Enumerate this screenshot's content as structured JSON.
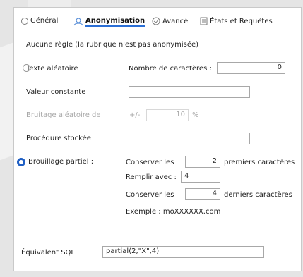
{
  "tabs": [
    {
      "label": "Général"
    },
    {
      "label": "Anonymisation"
    },
    {
      "label": "Avancé"
    },
    {
      "label": "États et Requêtes"
    }
  ],
  "options": {
    "none": "Aucune règle (la rubrique n'est pas anonymisée)",
    "random_text": "Texte aléatoire",
    "constant": "Valeur constante",
    "noise": "Bruitage aléatoire de",
    "stored_proc": "Procédure stockée",
    "partial": "Brouillage partiel :"
  },
  "random_text": {
    "chars_label": "Nombre de caractères :",
    "chars_value": "0"
  },
  "constant": {
    "value": ""
  },
  "noise": {
    "prefix": "+/-",
    "value": "10",
    "unit": "%"
  },
  "stored_proc": {
    "value": ""
  },
  "partial": {
    "keep_first_label": "Conserver les",
    "keep_first_value": "2",
    "keep_first_suffix": "premiers caractères",
    "fill_label": "Remplir avec :",
    "fill_value": "4",
    "keep_last_label": "Conserver les",
    "keep_last_value": "4",
    "keep_last_suffix": "derniers caractères",
    "example": "Exemple : moXXXXXX.com"
  },
  "sql": {
    "label": "Équivalent SQL",
    "value": "partial(2,\"X\",4)"
  },
  "colors": {
    "accent": "#1f5fc4",
    "border": "#a8a8a8",
    "disabled": "#a8a8a8"
  }
}
